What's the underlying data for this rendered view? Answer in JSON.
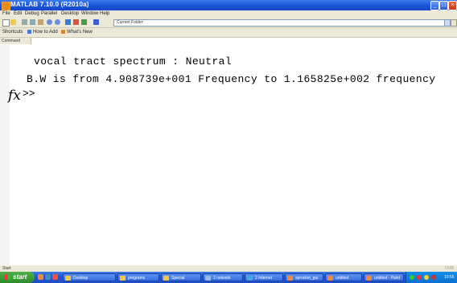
{
  "window": {
    "title": "MATLAB 7.10.0 (R2010a)",
    "controls": [
      "_",
      "□",
      "×"
    ]
  },
  "menubar": {
    "items": [
      "File",
      "Edit",
      "Debug",
      "Parallel",
      "Desktop",
      "Window",
      "Help"
    ]
  },
  "toolbar": {
    "icons": [
      "new-file",
      "open",
      "cut",
      "copy",
      "paste",
      "undo",
      "redo",
      "simulink",
      "guide",
      "profiler",
      "help"
    ],
    "current_folder_label": "Current Folder:"
  },
  "shortcuts": {
    "items": [
      "Shortcuts",
      "How to Add",
      "What's New"
    ]
  },
  "panel": {
    "tab_label": "Command Window"
  },
  "command_window": {
    "lines": [
      "vocal tract spectrum : Neutral",
      "B.W is from 4.908739e+001 Frequency to 1.165825e+002 frequency"
    ],
    "fx_label": "fx",
    "prompt": ">>"
  },
  "statusbar": {
    "left": "Start",
    "right": "OVR"
  },
  "taskbar": {
    "start_label": "start",
    "tasks": [
      "Desktop",
      "programs",
      "Special",
      "2 network",
      "2 Internet",
      "sprocket_gui",
      "untitled",
      "untitled - Paint"
    ],
    "clock": "10:55"
  },
  "colors": {
    "title_bar": "#1a53d6",
    "chrome": "#ece9d8",
    "taskbar": "#2456d2",
    "start_button": "#2e8b2a"
  }
}
